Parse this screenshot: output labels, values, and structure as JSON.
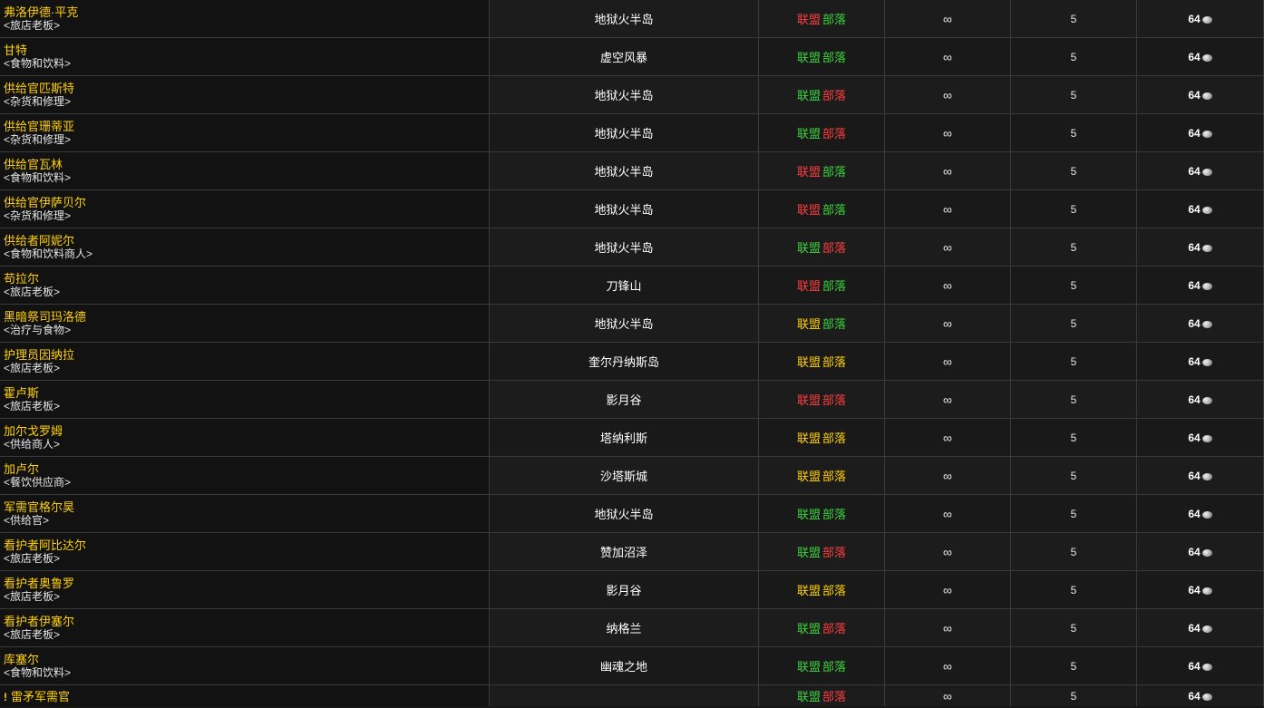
{
  "reaction_labels": {
    "alliance": "联盟",
    "horde": "部落"
  },
  "colors": {
    "hostile": "#fe3e3e",
    "friendly": "#3cd33c",
    "neutral": "#ffd100"
  },
  "rows": [
    {
      "name": "弗洛伊德·平克",
      "tag": "<旅店老板>",
      "zone": "地狱火半岛",
      "alliance": "hostile",
      "horde": "friendly",
      "stock": "∞",
      "slot": "5",
      "cost": "64"
    },
    {
      "name": "甘特",
      "tag": "<食物和饮料>",
      "zone": "虚空风暴",
      "alliance": "friendly",
      "horde": "friendly",
      "stock": "∞",
      "slot": "5",
      "cost": "64"
    },
    {
      "name": "供给官匹斯特",
      "tag": "<杂货和修理>",
      "zone": "地狱火半岛",
      "alliance": "friendly",
      "horde": "hostile",
      "stock": "∞",
      "slot": "5",
      "cost": "64"
    },
    {
      "name": "供给官珊蒂亚",
      "tag": "<杂货和修理>",
      "zone": "地狱火半岛",
      "alliance": "friendly",
      "horde": "hostile",
      "stock": "∞",
      "slot": "5",
      "cost": "64"
    },
    {
      "name": "供给官瓦林",
      "tag": "<食物和饮料>",
      "zone": "地狱火半岛",
      "alliance": "hostile",
      "horde": "friendly",
      "stock": "∞",
      "slot": "5",
      "cost": "64"
    },
    {
      "name": "供给官伊萨贝尔",
      "tag": "<杂货和修理>",
      "zone": "地狱火半岛",
      "alliance": "hostile",
      "horde": "friendly",
      "stock": "∞",
      "slot": "5",
      "cost": "64"
    },
    {
      "name": "供给者阿妮尔",
      "tag": "<食物和饮料商人>",
      "zone": "地狱火半岛",
      "alliance": "friendly",
      "horde": "hostile",
      "stock": "∞",
      "slot": "5",
      "cost": "64"
    },
    {
      "name": "苟拉尔",
      "tag": "<旅店老板>",
      "zone": "刀锋山",
      "alliance": "hostile",
      "horde": "friendly",
      "stock": "∞",
      "slot": "5",
      "cost": "64"
    },
    {
      "name": "黑暗祭司玛洛德",
      "tag": "<治疗与食物>",
      "zone": "地狱火半岛",
      "alliance": "neutral",
      "horde": "friendly",
      "stock": "∞",
      "slot": "5",
      "cost": "64"
    },
    {
      "name": "护理员因纳拉",
      "tag": "<旅店老板>",
      "zone": "奎尔丹纳斯岛",
      "alliance": "neutral",
      "horde": "neutral",
      "stock": "∞",
      "slot": "5",
      "cost": "64"
    },
    {
      "name": "霍卢斯",
      "tag": "<旅店老板>",
      "zone": "影月谷",
      "alliance": "hostile",
      "horde": "hostile",
      "stock": "∞",
      "slot": "5",
      "cost": "64"
    },
    {
      "name": "加尔戈罗姆",
      "tag": "<供给商人>",
      "zone": "塔纳利斯",
      "alliance": "neutral",
      "horde": "neutral",
      "stock": "∞",
      "slot": "5",
      "cost": "64"
    },
    {
      "name": "加卢尔",
      "tag": "<餐饮供应商>",
      "zone": "沙塔斯城",
      "alliance": "neutral",
      "horde": "neutral",
      "stock": "∞",
      "slot": "5",
      "cost": "64"
    },
    {
      "name": "军需官格尔昊",
      "tag": "<供给官>",
      "zone": "地狱火半岛",
      "alliance": "friendly",
      "horde": "friendly",
      "stock": "∞",
      "slot": "5",
      "cost": "64"
    },
    {
      "name": "看护者阿比达尔",
      "tag": "<旅店老板>",
      "zone": "赞加沼泽",
      "alliance": "friendly",
      "horde": "hostile",
      "stock": "∞",
      "slot": "5",
      "cost": "64"
    },
    {
      "name": "看护者奥鲁罗",
      "tag": "<旅店老板>",
      "zone": "影月谷",
      "alliance": "neutral",
      "horde": "neutral",
      "stock": "∞",
      "slot": "5",
      "cost": "64"
    },
    {
      "name": "看护者伊塞尔",
      "tag": "<旅店老板>",
      "zone": "纳格兰",
      "alliance": "friendly",
      "horde": "hostile",
      "stock": "∞",
      "slot": "5",
      "cost": "64"
    },
    {
      "name": "库塞尔",
      "tag": "<食物和饮料>",
      "zone": "幽魂之地",
      "alliance": "friendly",
      "horde": "friendly",
      "stock": "∞",
      "slot": "5",
      "cost": "64"
    }
  ],
  "last_row": {
    "icon": "!",
    "name": "雷矛军需官",
    "zone": "",
    "alliance": "friendly",
    "horde": "hostile",
    "stock": "∞",
    "slot": "5",
    "cost": "64"
  },
  "icons": {
    "coin": "silver-coin-icon",
    "quest": "exclamation-icon"
  }
}
